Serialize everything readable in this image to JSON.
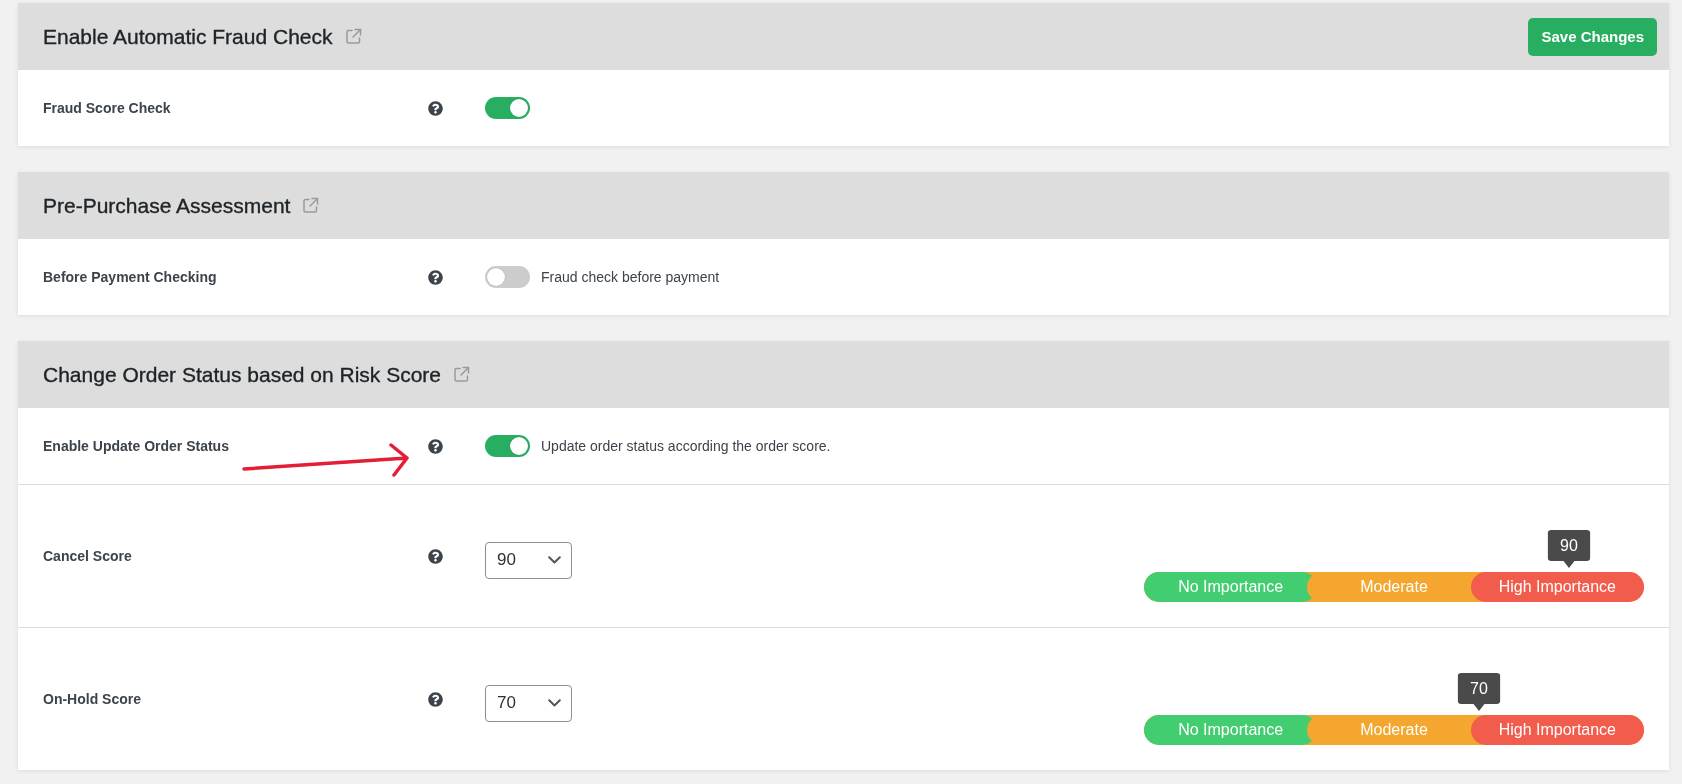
{
  "sections": [
    {
      "title": "Enable Automatic Fraud Check",
      "action": {
        "label": "Save Changes"
      },
      "rows": [
        {
          "kind": "toggle",
          "label": "Fraud Score Check",
          "on": true
        }
      ]
    },
    {
      "title": "Pre-Purchase Assessment",
      "rows": [
        {
          "kind": "toggle",
          "label": "Before Payment Checking",
          "on": false,
          "description": "Fraud check before payment"
        }
      ]
    },
    {
      "title": "Change Order Status based on Risk Score",
      "rows": [
        {
          "kind": "toggle",
          "label": "Enable Update Order Status",
          "on": true,
          "description": "Update order status according the order score."
        },
        {
          "kind": "score",
          "label": "Cancel Score",
          "value": "90",
          "scale": {
            "segments": [
              {
                "label": "No Importance",
                "color": "#43cd71"
              },
              {
                "label": "Moderate",
                "color": "#f4a62e"
              },
              {
                "label": "High Importance",
                "color": "#f25c4c"
              }
            ],
            "marker": "90",
            "level": 0.85
          }
        },
        {
          "kind": "score",
          "label": "On-Hold Score",
          "value": "70",
          "scale": {
            "segments": [
              {
                "label": "No Importance",
                "color": "#43cd71"
              },
              {
                "label": "Moderate",
                "color": "#f4a62e"
              },
              {
                "label": "High Importance",
                "color": "#f25c4c"
              }
            ],
            "marker": "70",
            "level": 0.67
          }
        }
      ]
    }
  ]
}
